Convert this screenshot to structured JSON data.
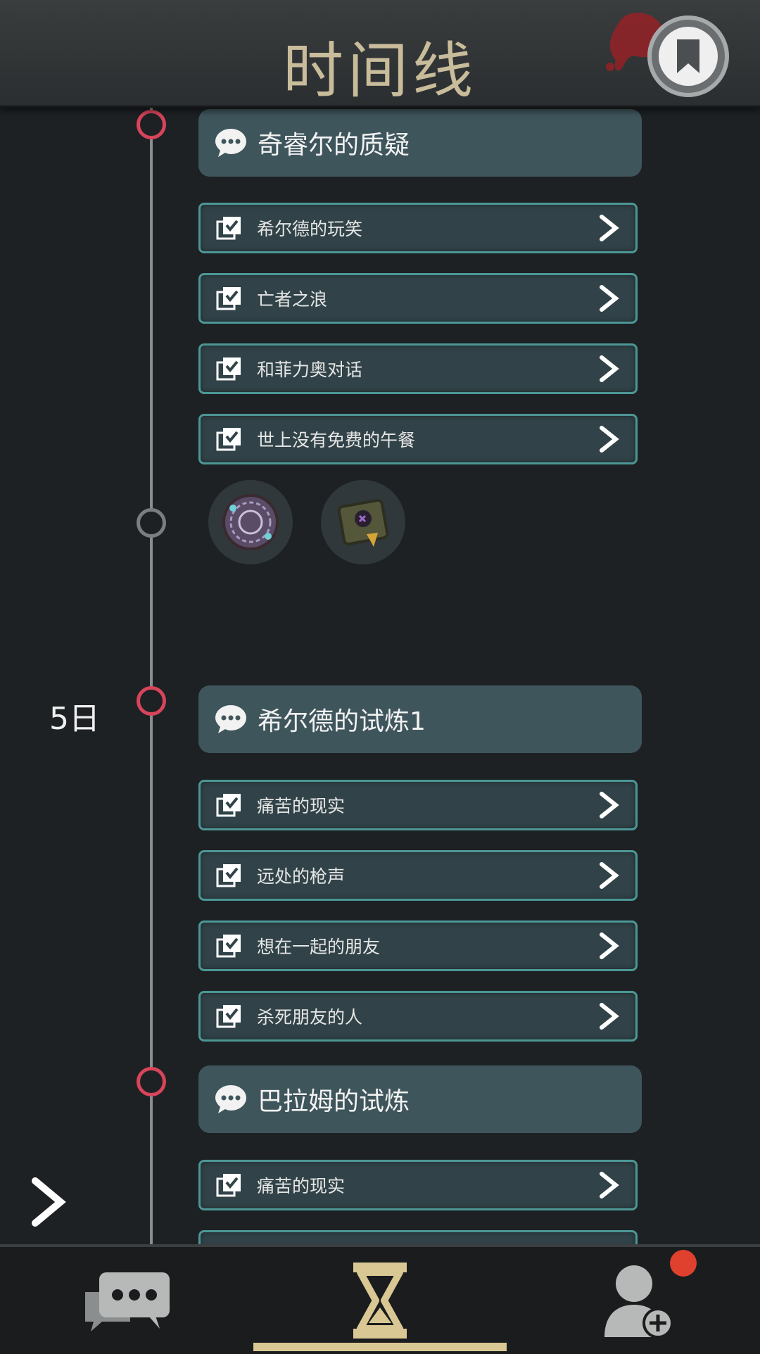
{
  "header": {
    "title": "时间线"
  },
  "date_label": "5日",
  "groups": [
    {
      "event": "奇睿尔的质疑",
      "tasks": [
        "希尔德的玩笑",
        "亡者之浪",
        "和菲力奥对话",
        "世上没有免费的午餐"
      ],
      "items": [
        "glyph-disc-icon",
        "tome-icon"
      ]
    },
    {
      "event": "希尔德的试炼1",
      "tasks": [
        "痛苦的现实",
        "远处的枪声",
        "想在一起的朋友",
        "杀死朋友的人"
      ]
    },
    {
      "event": "巴拉姆的试炼",
      "tasks": [
        "痛苦的现实"
      ]
    }
  ],
  "bottom_nav": [
    "chat-icon",
    "hourglass-icon",
    "add-contact-icon"
  ],
  "colors": {
    "accent": "#d9c893",
    "timeline_node": "#d8445a",
    "task_border": "#4c9795",
    "notification": "#e0402e"
  }
}
